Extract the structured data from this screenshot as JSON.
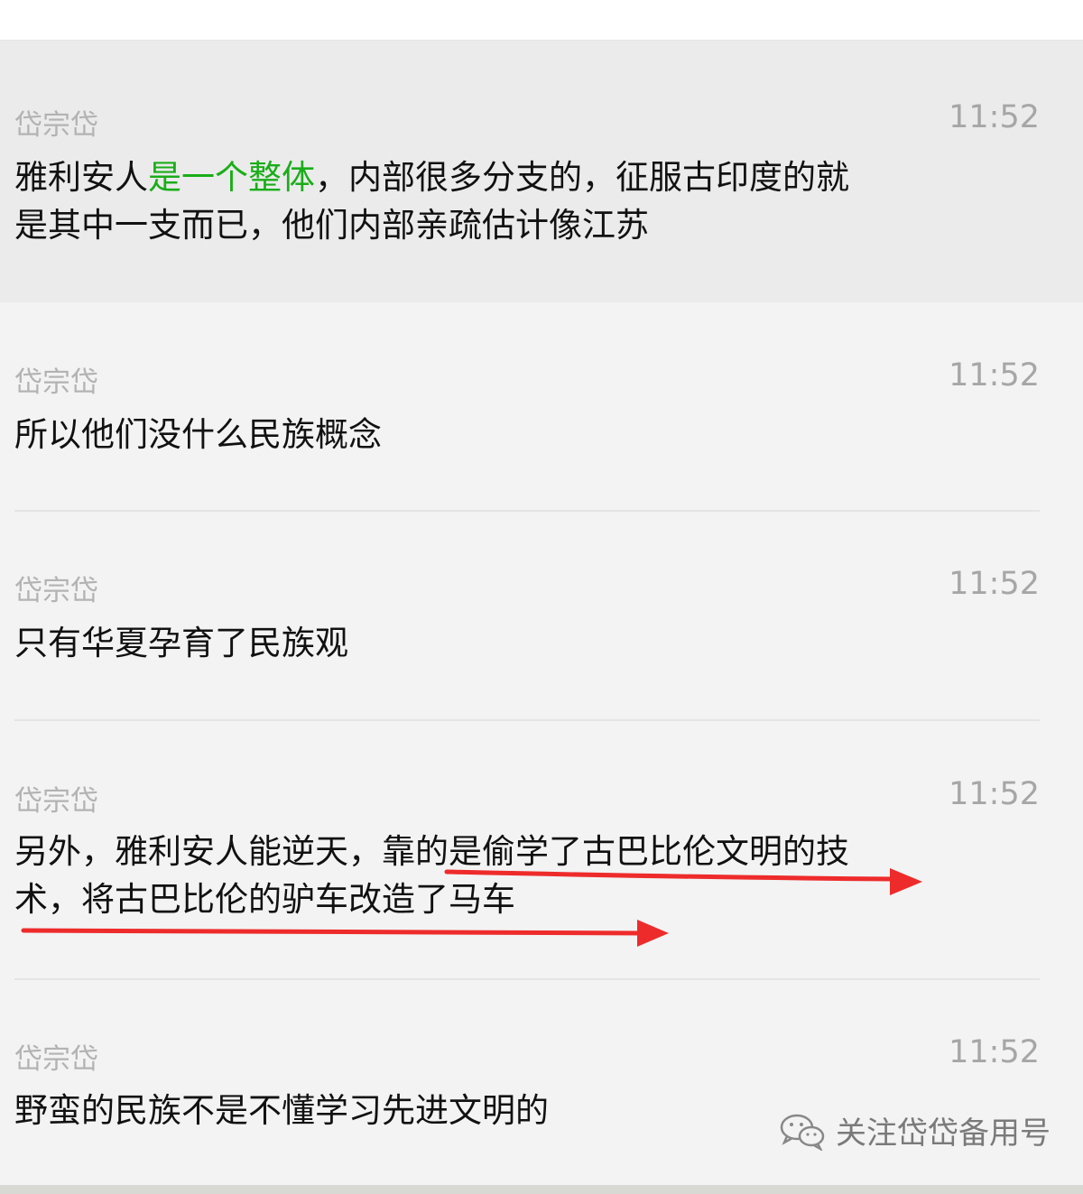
{
  "messages": [
    {
      "sender": "岱宗岱",
      "time": "11:52",
      "text_a": "雅利安人",
      "text_b": "是一个整体",
      "text_c": "，内部很多分支的，征服古印度的就是其中一支而已，他们内部亲疏估计像江苏"
    },
    {
      "sender": "岱宗岱",
      "time": "11:52",
      "text": "所以他们没什么民族概念"
    },
    {
      "sender": "岱宗岱",
      "time": "11:52",
      "text": "只有华夏孕育了民族观"
    },
    {
      "sender": "岱宗岱",
      "time": "11:52",
      "text": "另外，雅利安人能逆天，靠的是偷学了古巴比伦文明的技术，将古巴比伦的驴车改造了马车"
    },
    {
      "sender": "岱宗岱",
      "time": "11:52",
      "text": "野蛮的民族不是不懂学习先进文明的"
    }
  ],
  "watermark": {
    "text": "关注岱岱备用号",
    "icon": "wechat-icon"
  },
  "colors": {
    "highlight": "#1aad19",
    "annotation": "#ee2b2b"
  }
}
